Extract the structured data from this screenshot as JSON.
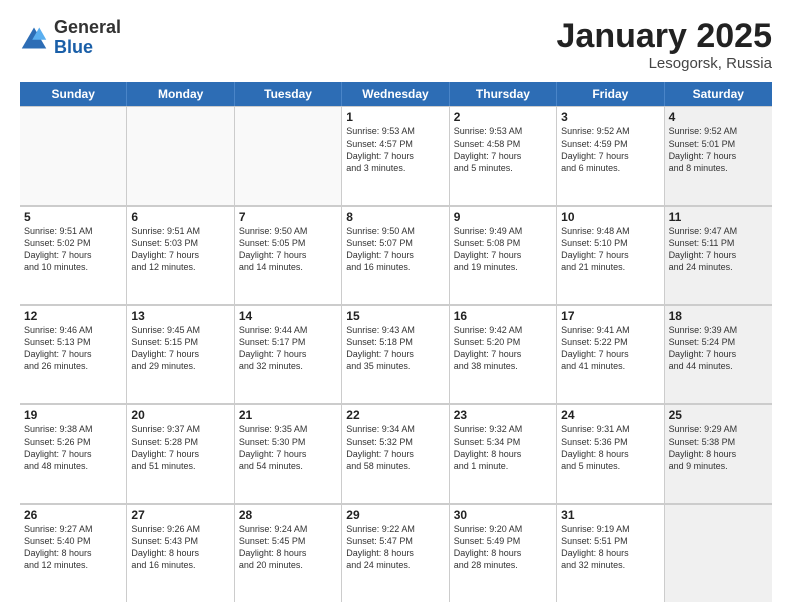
{
  "logo": {
    "general": "General",
    "blue": "Blue"
  },
  "header": {
    "title": "January 2025",
    "subtitle": "Lesogorsk, Russia"
  },
  "weekdays": [
    "Sunday",
    "Monday",
    "Tuesday",
    "Wednesday",
    "Thursday",
    "Friday",
    "Saturday"
  ],
  "weeks": [
    [
      {
        "day": "",
        "info": "",
        "empty": true
      },
      {
        "day": "",
        "info": "",
        "empty": true
      },
      {
        "day": "",
        "info": "",
        "empty": true
      },
      {
        "day": "1",
        "info": "Sunrise: 9:53 AM\nSunset: 4:57 PM\nDaylight: 7 hours\nand 3 minutes."
      },
      {
        "day": "2",
        "info": "Sunrise: 9:53 AM\nSunset: 4:58 PM\nDaylight: 7 hours\nand 5 minutes."
      },
      {
        "day": "3",
        "info": "Sunrise: 9:52 AM\nSunset: 4:59 PM\nDaylight: 7 hours\nand 6 minutes."
      },
      {
        "day": "4",
        "info": "Sunrise: 9:52 AM\nSunset: 5:01 PM\nDaylight: 7 hours\nand 8 minutes.",
        "shaded": true
      }
    ],
    [
      {
        "day": "5",
        "info": "Sunrise: 9:51 AM\nSunset: 5:02 PM\nDaylight: 7 hours\nand 10 minutes."
      },
      {
        "day": "6",
        "info": "Sunrise: 9:51 AM\nSunset: 5:03 PM\nDaylight: 7 hours\nand 12 minutes."
      },
      {
        "day": "7",
        "info": "Sunrise: 9:50 AM\nSunset: 5:05 PM\nDaylight: 7 hours\nand 14 minutes."
      },
      {
        "day": "8",
        "info": "Sunrise: 9:50 AM\nSunset: 5:07 PM\nDaylight: 7 hours\nand 16 minutes."
      },
      {
        "day": "9",
        "info": "Sunrise: 9:49 AM\nSunset: 5:08 PM\nDaylight: 7 hours\nand 19 minutes."
      },
      {
        "day": "10",
        "info": "Sunrise: 9:48 AM\nSunset: 5:10 PM\nDaylight: 7 hours\nand 21 minutes."
      },
      {
        "day": "11",
        "info": "Sunrise: 9:47 AM\nSunset: 5:11 PM\nDaylight: 7 hours\nand 24 minutes.",
        "shaded": true
      }
    ],
    [
      {
        "day": "12",
        "info": "Sunrise: 9:46 AM\nSunset: 5:13 PM\nDaylight: 7 hours\nand 26 minutes."
      },
      {
        "day": "13",
        "info": "Sunrise: 9:45 AM\nSunset: 5:15 PM\nDaylight: 7 hours\nand 29 minutes."
      },
      {
        "day": "14",
        "info": "Sunrise: 9:44 AM\nSunset: 5:17 PM\nDaylight: 7 hours\nand 32 minutes."
      },
      {
        "day": "15",
        "info": "Sunrise: 9:43 AM\nSunset: 5:18 PM\nDaylight: 7 hours\nand 35 minutes."
      },
      {
        "day": "16",
        "info": "Sunrise: 9:42 AM\nSunset: 5:20 PM\nDaylight: 7 hours\nand 38 minutes."
      },
      {
        "day": "17",
        "info": "Sunrise: 9:41 AM\nSunset: 5:22 PM\nDaylight: 7 hours\nand 41 minutes."
      },
      {
        "day": "18",
        "info": "Sunrise: 9:39 AM\nSunset: 5:24 PM\nDaylight: 7 hours\nand 44 minutes.",
        "shaded": true
      }
    ],
    [
      {
        "day": "19",
        "info": "Sunrise: 9:38 AM\nSunset: 5:26 PM\nDaylight: 7 hours\nand 48 minutes."
      },
      {
        "day": "20",
        "info": "Sunrise: 9:37 AM\nSunset: 5:28 PM\nDaylight: 7 hours\nand 51 minutes."
      },
      {
        "day": "21",
        "info": "Sunrise: 9:35 AM\nSunset: 5:30 PM\nDaylight: 7 hours\nand 54 minutes."
      },
      {
        "day": "22",
        "info": "Sunrise: 9:34 AM\nSunset: 5:32 PM\nDaylight: 7 hours\nand 58 minutes."
      },
      {
        "day": "23",
        "info": "Sunrise: 9:32 AM\nSunset: 5:34 PM\nDaylight: 8 hours\nand 1 minute."
      },
      {
        "day": "24",
        "info": "Sunrise: 9:31 AM\nSunset: 5:36 PM\nDaylight: 8 hours\nand 5 minutes."
      },
      {
        "day": "25",
        "info": "Sunrise: 9:29 AM\nSunset: 5:38 PM\nDaylight: 8 hours\nand 9 minutes.",
        "shaded": true
      }
    ],
    [
      {
        "day": "26",
        "info": "Sunrise: 9:27 AM\nSunset: 5:40 PM\nDaylight: 8 hours\nand 12 minutes."
      },
      {
        "day": "27",
        "info": "Sunrise: 9:26 AM\nSunset: 5:43 PM\nDaylight: 8 hours\nand 16 minutes."
      },
      {
        "day": "28",
        "info": "Sunrise: 9:24 AM\nSunset: 5:45 PM\nDaylight: 8 hours\nand 20 minutes."
      },
      {
        "day": "29",
        "info": "Sunrise: 9:22 AM\nSunset: 5:47 PM\nDaylight: 8 hours\nand 24 minutes."
      },
      {
        "day": "30",
        "info": "Sunrise: 9:20 AM\nSunset: 5:49 PM\nDaylight: 8 hours\nand 28 minutes."
      },
      {
        "day": "31",
        "info": "Sunrise: 9:19 AM\nSunset: 5:51 PM\nDaylight: 8 hours\nand 32 minutes."
      },
      {
        "day": "",
        "info": "",
        "empty": true,
        "shaded": true
      }
    ]
  ]
}
